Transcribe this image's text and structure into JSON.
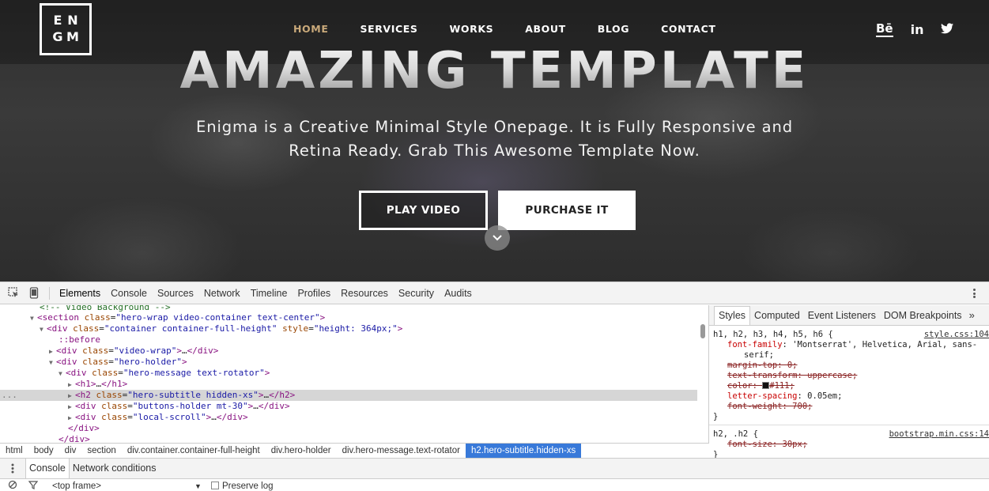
{
  "hero": {
    "logo": [
      "E",
      "N",
      "G",
      "M"
    ],
    "nav": [
      "HOME",
      "SERVICES",
      "WORKS",
      "ABOUT",
      "BLOG",
      "CONTACT"
    ],
    "social": {
      "behance": "Bē",
      "linkedin": "in"
    },
    "title": "AMAZING TEMPLATE",
    "subtitle_line1": "Enigma is a Creative Minimal Style Onepage. It is Fully Responsive and",
    "subtitle_line2": "Retina Ready. Grab This Awesome Template Now.",
    "play_button": "PLAY VIDEO",
    "purchase_button": "PURCHASE IT",
    "colors": {
      "nav_active": "#c9a97a",
      "hero_bg": "#333333"
    }
  },
  "devtools": {
    "tabs": [
      "Elements",
      "Console",
      "Sources",
      "Network",
      "Timeline",
      "Profiles",
      "Resources",
      "Security",
      "Audits"
    ],
    "dom": {
      "comment": "<!-- Video Background -->",
      "section_tag": "section",
      "section_class": "hero-wrap video-container text-center",
      "container_class": "container container-full-height",
      "container_style": "height: 364px;",
      "before": "::before",
      "video_wrap_class": "video-wrap",
      "hero_holder_class": "hero-holder",
      "hero_message_class": "hero-message text-rotator",
      "h1": "h1",
      "h2_class": "hero-subtitle hidden-xs",
      "buttons_class": "buttons-holder mt-30",
      "local_scroll_class": "local-scroll",
      "close_div": "</div>",
      "gutter": "..."
    },
    "breadcrumbs": [
      "html",
      "body",
      "div",
      "section",
      "div.container.container-full-height",
      "div.hero-holder",
      "div.hero-message.text-rotator",
      "h2.hero-subtitle.hidden-xs"
    ],
    "styles_tabs": [
      "Styles",
      "Computed",
      "Event Listeners",
      "DOM Breakpoints"
    ],
    "styles": {
      "rule1_selector": "h1, h2, h3, h4, h5, h6 {",
      "rule1_source": "style.css:104",
      "font_family_prop": "font-family",
      "font_family_val": "'Montserrat', Helvetica, Arial, sans-",
      "font_family_cont": "serif;",
      "margin_top": "margin-top: 0;",
      "text_transform": "text-transform: uppercase;",
      "color_prop": "color",
      "color_val": "#111;",
      "letter_spacing_prop": "letter-spacing",
      "letter_spacing_val": "0.05em;",
      "font_weight": "font-weight: 700;",
      "close": "}",
      "rule2_selector": "h2, .h2 {",
      "rule2_source": "bootstrap.min.css:14",
      "font_size": "font-size: 30px;"
    },
    "console_tabs": [
      "Console",
      "Network conditions"
    ],
    "frame_select": "<top frame>",
    "preserve_log": "Preserve log"
  }
}
